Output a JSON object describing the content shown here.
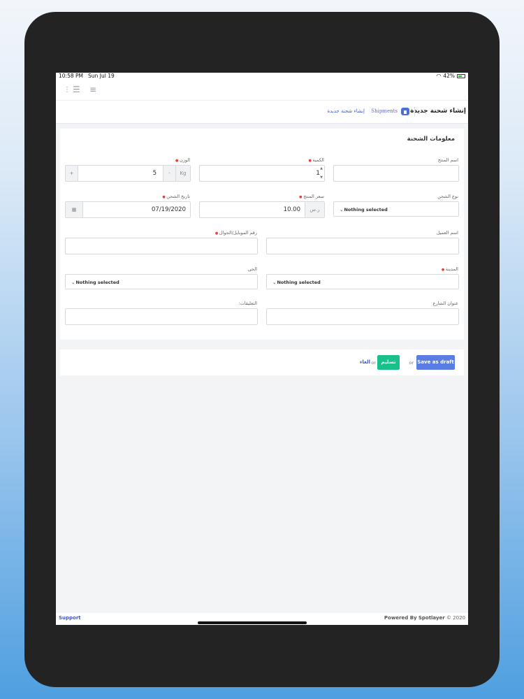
{
  "status_bar": {
    "time": "10:58 PM",
    "date": "Sun Jul 19",
    "battery": "42%"
  },
  "header": {
    "page_title": "إنشاء شحنة جديدة",
    "breadcrumb_shipments": "Shipments",
    "breadcrumb_current": "إنشاء شحنة جديدة"
  },
  "form": {
    "section_title": "معلومات الشحنة",
    "product_name_label": "اسم المنتج",
    "product_name_value": "",
    "quantity_label": "الكمية",
    "quantity_value": "1",
    "weight_label": "الوزن",
    "weight_value": "5",
    "weight_unit": "Kg",
    "weight_minus": "-",
    "weight_plus": "+",
    "shipping_type_label": "نوع الشحن",
    "shipping_type_value": "Nothing selected",
    "product_price_label": "سعر المنتج",
    "product_price_value": "10.00",
    "currency": "ر.س",
    "shipping_date_label": "تاريخ الشحن",
    "shipping_date_value": "07/19/2020",
    "customer_name_label": "اسم العميل",
    "customer_name_value": "",
    "mobile_label": "رقم الموبايل/الجوال",
    "mobile_value": "",
    "city_label": "المدينة",
    "city_value": "Nothing selected",
    "district_label": "الحي",
    "district_value": "Nothing selected",
    "street_label": "عنوان الشارع",
    "street_value": "",
    "notes_label": "التعليقات:",
    "notes_value": ""
  },
  "actions": {
    "save_draft": "Save as draft",
    "or": "or",
    "submit": "تسليم",
    "cancel": "الغاء"
  },
  "footer": {
    "support": "Support",
    "powered_by": "Powered By",
    "brand": "Spotlayer",
    "copyright": "© 2020"
  }
}
